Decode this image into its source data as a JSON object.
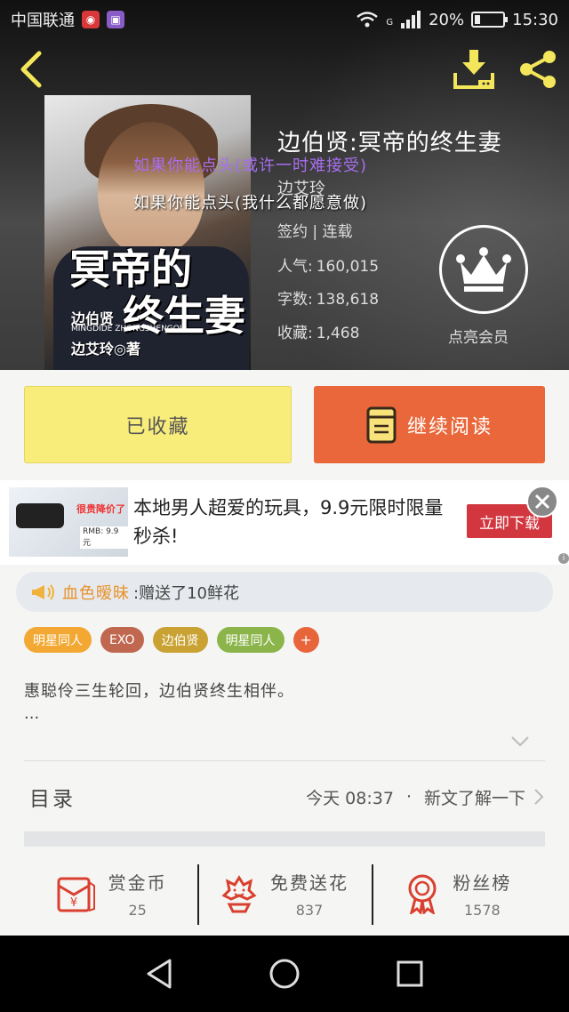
{
  "status_bar": {
    "carrier": "中国联通",
    "network": "G",
    "battery": "20%",
    "time": "15:30"
  },
  "book": {
    "title": "边伯贤:冥帝的终生妻",
    "author": "边艾玲",
    "status": "签约 | 连载",
    "popularity_label": "人气:",
    "popularity": "160,015",
    "words_label": "字数:",
    "words": "138,618",
    "favorites_label": "收藏:",
    "favorites": "1,468",
    "vip_label": "点亮会员"
  },
  "cover": {
    "title_line1": "冥帝的",
    "title_line2": "终生妻",
    "author_text": "边伯贤",
    "pinyin": "MINGDIDE ZHONGSHENGQI",
    "author_credit": "边艾玲◎著"
  },
  "overlay": {
    "line1": "如果你能点头(或许一时难接受)",
    "line2": "如果你能点头(我什么都愿意做)"
  },
  "actions": {
    "collected_label": "已收藏",
    "read_label": "继续阅读"
  },
  "ad": {
    "text": "本地男人超爱的玩具，9.9元限时限量秒杀!",
    "cta": "立即下载",
    "image_tag": "很贵降价了",
    "image_price": "RMB: 9.9元"
  },
  "gift": {
    "user": "血色暧昧",
    "message": ":赠送了10鲜花"
  },
  "tags": [
    {
      "label": "明星同人",
      "color": "#f2a832"
    },
    {
      "label": "EXO",
      "color": "#c0674f"
    },
    {
      "label": "边伯贤",
      "color": "#c9a233"
    },
    {
      "label": "明星同人",
      "color": "#8bb54a"
    }
  ],
  "tags_add": "+",
  "intro": {
    "text": "惠聪伶三生轮回，边伯贤终生相伴。",
    "ellipsis": "..."
  },
  "toc": {
    "label": "目录",
    "time": "今天 08:37",
    "dot": "·",
    "latest": "新文了解一下"
  },
  "stats": [
    {
      "name": "赏金币",
      "value": "25",
      "icon": "red-envelope-icon"
    },
    {
      "name": "免费送花",
      "value": "837",
      "icon": "flower-icon"
    },
    {
      "name": "粉丝榜",
      "value": "1578",
      "icon": "medal-icon"
    }
  ],
  "colors": {
    "accent_orange": "#e9673a",
    "collected_yellow": "#f8ec7b",
    "icon_yellow": "#f3e65a",
    "icon_red": "#d9402f"
  }
}
